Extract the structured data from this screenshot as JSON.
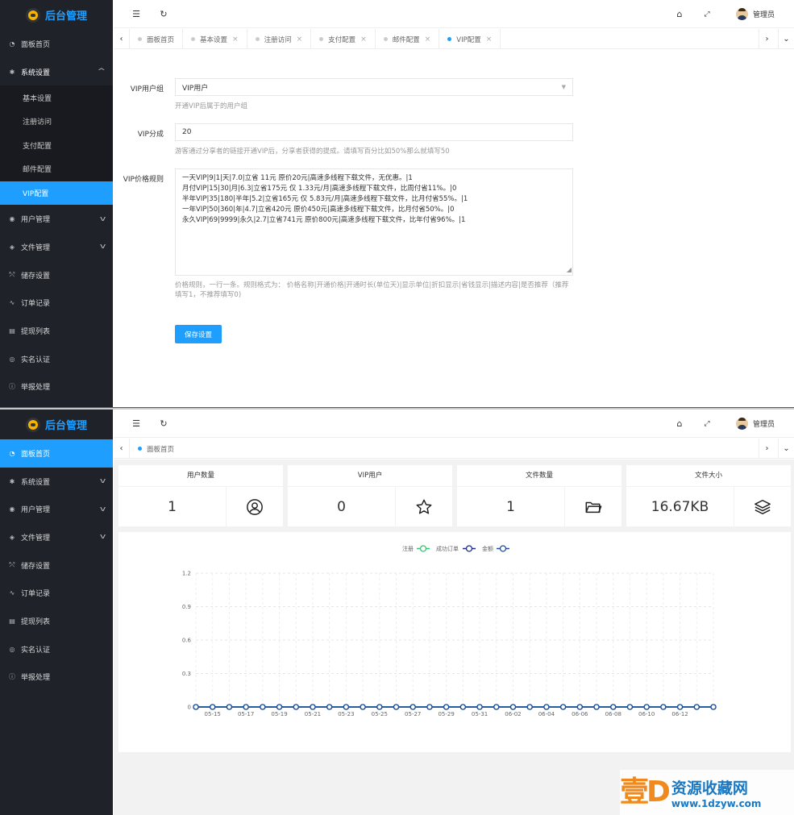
{
  "app": {
    "logo_text": "后台管理",
    "user_name": "管理员"
  },
  "menu_top": {
    "items": [
      {
        "label": "面板首页",
        "icon": "dashboard-icon"
      },
      {
        "label": "系统设置",
        "icon": "gear-icon",
        "open": true
      },
      {
        "label": "用户管理",
        "icon": "user-icon"
      },
      {
        "label": "文件管理",
        "icon": "layers-icon"
      },
      {
        "label": "储存设置",
        "icon": "storage-icon"
      },
      {
        "label": "订单记录",
        "icon": "pulse-icon"
      },
      {
        "label": "提现列表",
        "icon": "list-icon"
      },
      {
        "label": "实名认证",
        "icon": "shield-icon"
      },
      {
        "label": "举报处理",
        "icon": "info-icon"
      }
    ],
    "sub_items": [
      "基本设置",
      "注册访问",
      "支付配置",
      "邮件配置",
      "VIP配置"
    ]
  },
  "menu_bottom": {
    "items": [
      {
        "label": "面板首页"
      },
      {
        "label": "系统设置"
      },
      {
        "label": "用户管理"
      },
      {
        "label": "文件管理"
      },
      {
        "label": "储存设置"
      },
      {
        "label": "订单记录"
      },
      {
        "label": "提现列表"
      },
      {
        "label": "实名认证"
      },
      {
        "label": "举报处理"
      }
    ]
  },
  "tabs_top": [
    "面板首页",
    "基本设置",
    "注册访问",
    "支付配置",
    "邮件配置",
    "VIP配置"
  ],
  "tabs_bottom": [
    "面板首页"
  ],
  "form": {
    "vip_group_label": "VIP用户组",
    "vip_group_value": "VIP用户",
    "vip_group_hint": "开通VIP后属于的用户组",
    "vip_share_label": "VIP分成",
    "vip_share_value": "20",
    "vip_share_hint": "游客通过分享者的链接开通VIP后，分享者获得的提成。请填写百分比如50%那么就填写50",
    "vip_rules_label": "VIP价格规则",
    "vip_rules_lines": [
      "一天VIP|9|1|天|7.0|立省 11元 原价20元|高速多线程下载文件，无优惠。|1",
      "月付VIP|15|30|月|6.3|立省175元 仅 1.33元/月|高速多线程下载文件，比周付省11%。|0",
      "半年VIP|35|180|半年|5.2|立省165元 仅 5.83元/月|高速多线程下载文件，比月付省55%。|1",
      "一年VIP|50|360|年|4.7|立省420元 原价450元|高速多线程下载文件，比月付省50%。|0",
      "永久VIP|69|9999|永久|2.7|立省741元 原价800元|高速多线程下载文件，比年付省96%。|1"
    ],
    "vip_rules_hint": "价格规则，一行一条。规则格式为：  价格名称|开通价格|开通时长(单位天)|显示单位|折扣显示|省钱显示|描述内容|是否推荐（推荐填写1，不推荐填写0)",
    "save_label": "保存设置"
  },
  "stats": [
    {
      "title": "用户数量",
      "value": "1",
      "icon": "user-circle-icon"
    },
    {
      "title": "VIP用户",
      "value": "0",
      "icon": "star-icon"
    },
    {
      "title": "文件数量",
      "value": "1",
      "icon": "folder-icon"
    },
    {
      "title": "文件大小",
      "value": "16.67KB",
      "icon": "layers-icon"
    }
  ],
  "colors": {
    "accent": "#1e9fff",
    "sidebar": "#20222a",
    "series_register": "#2ec770",
    "series_orders": "#1a2c8c",
    "series_amount": "#1a4ea0"
  },
  "chart_data": {
    "type": "line",
    "legend": [
      "注册",
      "成功订单",
      "金额"
    ],
    "legend_position": "top-center",
    "x": [
      "05-14",
      "05-15",
      "05-16",
      "05-17",
      "05-18",
      "05-19",
      "05-20",
      "05-21",
      "05-22",
      "05-23",
      "05-24",
      "05-25",
      "05-26",
      "05-27",
      "05-28",
      "05-29",
      "05-30",
      "05-31",
      "06-01",
      "06-02",
      "06-03",
      "06-04",
      "06-05",
      "06-06",
      "06-07",
      "06-08",
      "06-09",
      "06-10",
      "06-11",
      "06-12",
      "06-13",
      "06-14"
    ],
    "x_tick_labels": [
      "05-15",
      "05-17",
      "05-19",
      "05-21",
      "05-23",
      "05-25",
      "05-27",
      "05-29",
      "05-31",
      "06-02",
      "06-04",
      "06-06",
      "06-08",
      "06-10",
      "06-12"
    ],
    "y_ticks": [
      "0",
      "0.3",
      "0.6",
      "0.9",
      "1.2"
    ],
    "ylim": [
      0,
      1.2
    ],
    "grid": true,
    "series": [
      {
        "name": "注册",
        "values": [
          0,
          0,
          0,
          0,
          0,
          0,
          0,
          0,
          0,
          0,
          0,
          0,
          0,
          0,
          0,
          0,
          0,
          0,
          0,
          0,
          0,
          0,
          0,
          0,
          0,
          0,
          0,
          0,
          0,
          0,
          0,
          0
        ]
      },
      {
        "name": "成功订单",
        "values": [
          0,
          0,
          0,
          0,
          0,
          0,
          0,
          0,
          0,
          0,
          0,
          0,
          0,
          0,
          0,
          0,
          0,
          0,
          0,
          0,
          0,
          0,
          0,
          0,
          0,
          0,
          0,
          0,
          0,
          0,
          0,
          0
        ]
      },
      {
        "name": "金额",
        "values": [
          0,
          0,
          0,
          0,
          0,
          0,
          0,
          0,
          0,
          0,
          0,
          0,
          0,
          0,
          0,
          0,
          0,
          0,
          0,
          0,
          0,
          0,
          0,
          0,
          0,
          0,
          0,
          0,
          0,
          0,
          0,
          0
        ]
      }
    ]
  },
  "watermark": {
    "big": "壹D",
    "title": "资源收藏网",
    "url": "www.1dzyw.com"
  }
}
